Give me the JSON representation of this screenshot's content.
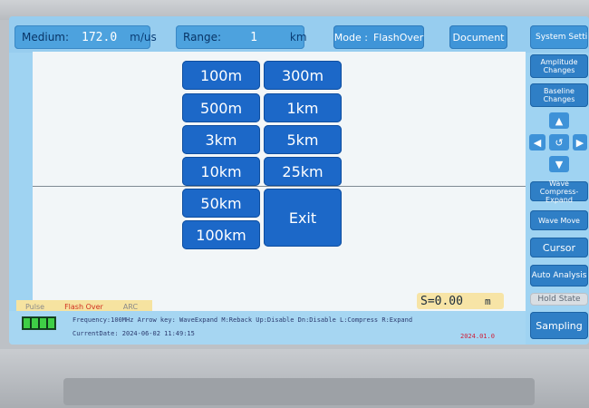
{
  "topbar": {
    "medium_label": "Medium:",
    "medium_value": "172.0",
    "medium_unit": "m/us",
    "range_label": "Range:",
    "range_value": "1",
    "range_unit": "km",
    "mode_label": "Mode :",
    "mode_value": "FlashOver",
    "document": "Document",
    "system_settings": "System Setting"
  },
  "right_panel": {
    "amplitude": "Amplitude Changes",
    "baseline": "Baseline Changes",
    "wave_compress": "Wave Compress-Expand",
    "wave_move": "Wave Move",
    "cursor": "Cursor",
    "auto_analysis": "Auto Analysis",
    "hold_state": "Hold State",
    "sampling": "Sampling"
  },
  "range_menu": {
    "r100m": "100m",
    "r300m": "300m",
    "r500m": "500m",
    "r1km": "1km",
    "r3km": "3km",
    "r5km": "5km",
    "r10km": "10km",
    "r25km": "25km",
    "r50km": "50km",
    "r100km": "100km",
    "exit": "Exit"
  },
  "modes": {
    "pulse": "Pulse",
    "flash_over": "Flash Over",
    "arc": "ARC"
  },
  "distance": {
    "label": "S=",
    "value": "0.00",
    "unit": "m"
  },
  "status": {
    "line1": "Frequency:100MHz Arrow key:  WaveExpand  M:Reback   Up:Disable  Dn:Disable  L:Compress  R:Expand",
    "line2": "CurrentDate: 2024-06-02 11:49:15",
    "version": "2024.01.0"
  },
  "colors": {
    "screen": "#9fd3f2",
    "button": "#1c68c8",
    "highlight": "#f7e4a6"
  }
}
